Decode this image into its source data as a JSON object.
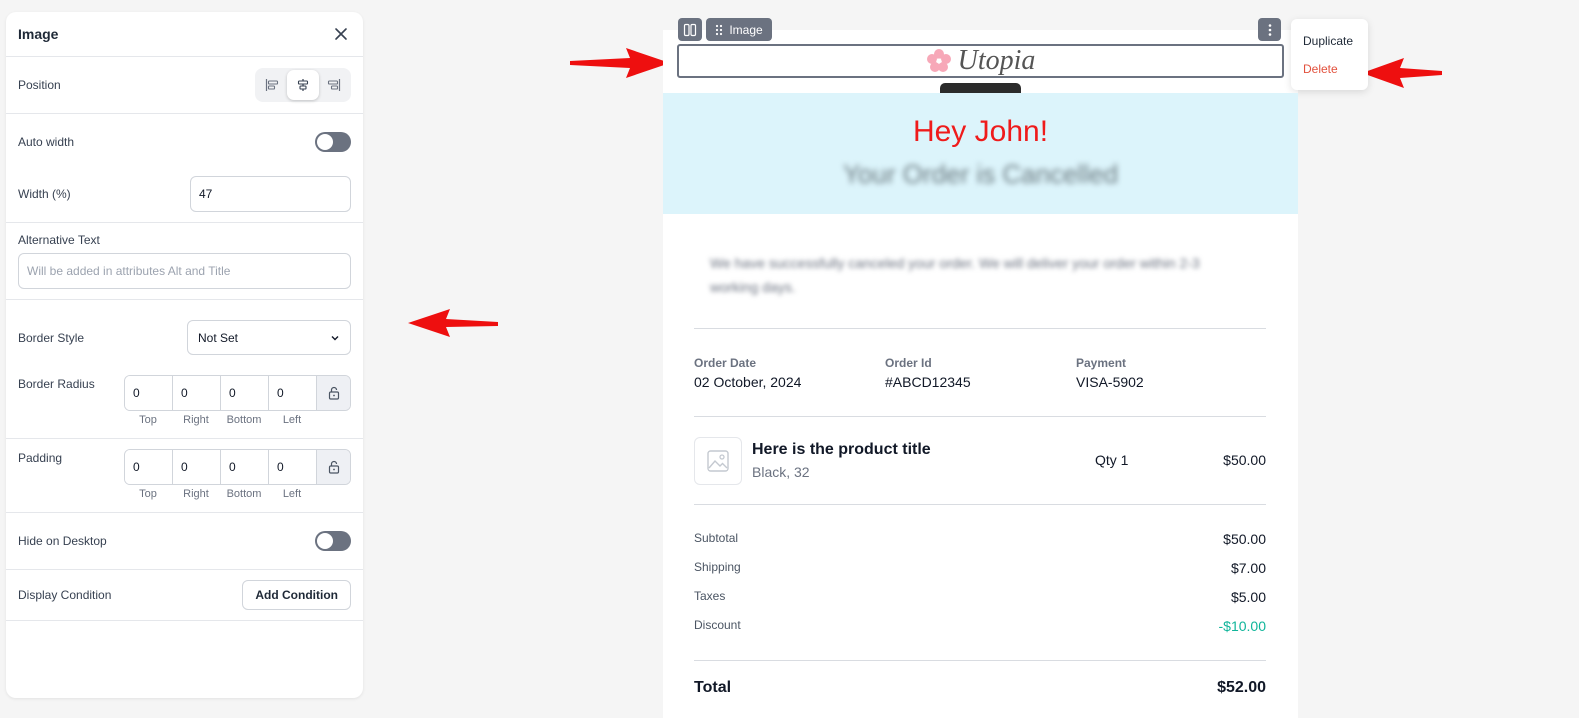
{
  "panel": {
    "title": "Image",
    "position_label": "Position",
    "auto_width_label": "Auto width",
    "width_label": "Width (%)",
    "width_value": "47",
    "alt_label": "Alternative Text",
    "alt_placeholder": "Will be added in attributes Alt and Title",
    "border_style_label": "Border Style",
    "border_style_value": "Not Set",
    "border_radius_label": "Border Radius",
    "border_radius": {
      "top": "0",
      "right": "0",
      "bottom": "0",
      "left": "0"
    },
    "padding_label": "Padding",
    "padding": {
      "top": "0",
      "right": "0",
      "bottom": "0",
      "left": "0"
    },
    "side_labels": {
      "top": "Top",
      "right": "Right",
      "bottom": "Bottom",
      "left": "Left"
    },
    "hide_desktop_label": "Hide on Desktop",
    "display_condition_label": "Display Condition",
    "add_condition_label": "Add Condition"
  },
  "block_chip": {
    "label": "Image"
  },
  "context_menu": {
    "duplicate": "Duplicate",
    "delete": "Delete"
  },
  "email": {
    "logo_text": "Utopia",
    "hero_title": "Hey John!",
    "hero_subtitle": "Your Order is Cancelled",
    "intro": "We have successfully canceled your order. We will deliver your order within 2-3 working days.",
    "meta": {
      "order_date_label": "Order Date",
      "order_date": "02 October, 2024",
      "order_id_label": "Order Id",
      "order_id": "#ABCD12345",
      "payment_label": "Payment",
      "payment": "VISA-5902"
    },
    "product": {
      "title": "Here is the product title",
      "variant": "Black, 32",
      "qty": "Qty 1",
      "price": "$50.00"
    },
    "summary": {
      "subtotal_label": "Subtotal",
      "subtotal": "$50.00",
      "shipping_label": "Shipping",
      "shipping": "$7.00",
      "taxes_label": "Taxes",
      "taxes": "$5.00",
      "discount_label": "Discount",
      "discount": "-$10.00",
      "total_label": "Total",
      "total": "$52.00"
    }
  },
  "colors": {
    "accent_delete": "#e2513d",
    "discount": "#10b59a",
    "hero_bg": "#dcf4fb",
    "hero_title": "#ef1b1b",
    "arrow": "#ee0f0f"
  }
}
